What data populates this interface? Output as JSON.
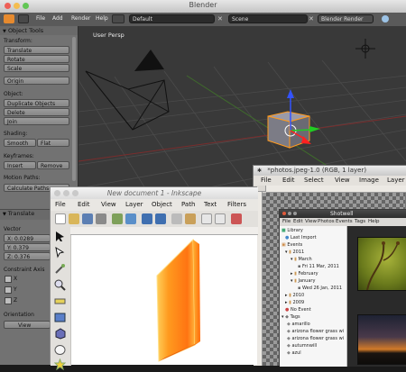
{
  "blender": {
    "window_title": "Blender",
    "menus": [
      "File",
      "Add",
      "Render",
      "Help"
    ],
    "layout_field": "Default",
    "scene_field": "Scene",
    "render_engine": "Blender Render",
    "viewport_label": "User Persp",
    "toolshelf": {
      "header": "Object Tools",
      "transform_label": "Transform:",
      "translate": "Translate",
      "rotate": "Rotate",
      "scale": "Scale",
      "origin": "Origin",
      "object_label": "Object:",
      "duplicate_objects": "Duplicate Objects",
      "delete": "Delete",
      "join": "Join",
      "shading_label": "Shading:",
      "smooth": "Smooth",
      "flat": "Flat",
      "keyframes_label": "Keyframes:",
      "insert": "Insert",
      "remove": "Remove",
      "motion_paths_label": "Motion Paths:",
      "calculate_paths": "Calculate Paths",
      "operator_header": "Translate",
      "vector_label": "Vector",
      "x_value": "X: 0.0289",
      "y_value": "Y: 0.379",
      "z_value": "Z: 0.376",
      "constraint_label": "Constraint Axis",
      "axis_x": "X",
      "axis_y": "Y",
      "axis_z": "Z",
      "orientation_label": "Orientation",
      "view_label": "View"
    }
  },
  "gimp": {
    "title": "*photos.jpeg-1.0 (RGB, 1 layer)",
    "menus": [
      "File",
      "Edit",
      "Select",
      "View",
      "Image",
      "Layer"
    ]
  },
  "shotwell": {
    "title": "Shotwell",
    "menus": [
      "File",
      "Edit",
      "View",
      "Photos",
      "Events",
      "Tags",
      "Help"
    ],
    "sidebar": {
      "library": "Library",
      "last_import": "Last Import",
      "events": "Events",
      "y2011": "2011",
      "march": "March",
      "fri_march": "Fri 11 Mar, 2011",
      "february": "February",
      "january": "January",
      "wed_jan": "Wed 26 Jan, 2011",
      "y2010": "2010",
      "y2009": "2009",
      "no_event": "No Event",
      "tags": "Tags",
      "amarillo": "amarillo",
      "arizona1": "arizona flower grass wi",
      "arizona2": "arizona flower grass wi",
      "autumnwill": "autumnwill",
      "azul": "azul"
    }
  },
  "inkscape": {
    "title": "New document 1 - Inkscape",
    "menus": [
      "File",
      "Edit",
      "View",
      "Layer",
      "Object",
      "Path",
      "Text",
      "Filters"
    ]
  },
  "colors": {
    "blender_bg": "#3d3d3d",
    "viewport_bg": "#393939",
    "selection_orange": "#ff9a1f",
    "inkscape_shape_orange": "#ff7a12"
  }
}
